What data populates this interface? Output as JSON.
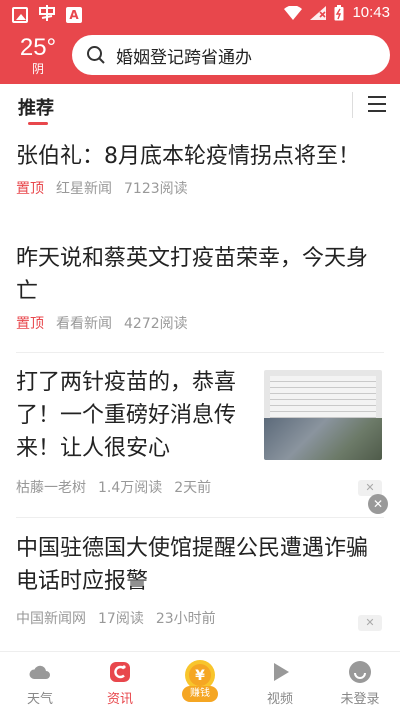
{
  "status_bar": {
    "time": "10:43"
  },
  "weather": {
    "temperature": "25°",
    "condition": "阴"
  },
  "search": {
    "value": "婚姻登记跨省通办"
  },
  "tabs": {
    "active": "推荐"
  },
  "feed": [
    {
      "title": "张伯礼：8月底本轮疫情拐点将至！",
      "tag": "置顶",
      "source": "红星新闻",
      "reads": "7123阅读"
    },
    {
      "title": "昨天说和蔡英文打疫苗荣幸，今天身亡",
      "tag": "置顶",
      "source": "看看新闻",
      "reads": "4272阅读"
    },
    {
      "title": "打了两针疫苗的，恭喜了！一个重磅好消息传来！让人很安心",
      "source": "枯藤一老树",
      "reads": "1.4万阅读",
      "time": "2天前"
    },
    {
      "title": "中国驻德国大使馆提醒公民遭遇诈骗电话时应报警",
      "source": "中国新闻网",
      "reads": "17阅读",
      "time": "23小时前"
    }
  ],
  "bottom_nav": {
    "weather": "天气",
    "news": "资讯",
    "earn_badge": "赚钱",
    "video": "视频",
    "login": "未登录"
  },
  "colors": {
    "accent": "#e8474c",
    "earn": "#f5a623"
  }
}
